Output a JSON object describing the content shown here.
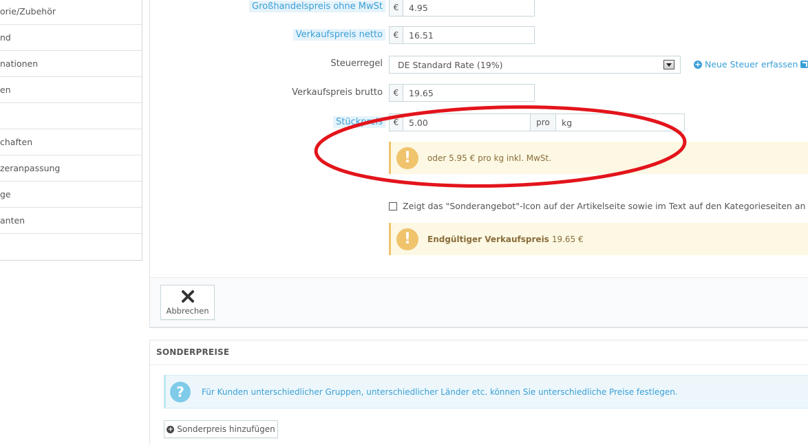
{
  "sidebar": {
    "items": [
      {
        "label": "orie/Zubehör"
      },
      {
        "label": "nd"
      },
      {
        "label": "nationen"
      },
      {
        "label": "en"
      },
      {
        "label": ""
      },
      {
        "label": "chaften"
      },
      {
        "label": "zeranpassung"
      },
      {
        "label": "ge"
      },
      {
        "label": "anten"
      },
      {
        "label": ""
      }
    ]
  },
  "pricing": {
    "wholesale_label": "Großhandelspreis ohne MwSt",
    "wholesale_currency": "€",
    "wholesale_value": "4.95",
    "net_label": "Verkaufspreis netto",
    "net_currency": "€",
    "net_value": "16.51",
    "tax_rule_label": "Steuerregel",
    "tax_rule_value": "DE Standard Rate (19%)",
    "new_tax_link": "Neue Steuer erfassen",
    "gross_label": "Verkaufspreis brutto",
    "gross_currency": "€",
    "gross_value": "19.65",
    "unit_label": "Stückpreis",
    "unit_currency": "€",
    "unit_value": "5.00",
    "unit_per": "pro",
    "unit_name": "kg",
    "unit_alert": "oder 5.95 € pro kg inkl. MwSt.",
    "special_offer_checkbox": "Zeigt das \"Sonderangebot\"-Icon auf der Artikelseite sowie im Text auf den Kategorieseiten an",
    "final_price_label": "Endgültiger Verkaufspreis",
    "final_price_value": "19.65 €"
  },
  "footer": {
    "cancel_label": "Abbrechen"
  },
  "special_prices": {
    "title": "SONDERPREISE",
    "info_text": "Für Kunden unterschiedlicher Gruppen, unterschiedlicher Länder etc. können Sie unterschiedliche Preise festlegen.",
    "add_button": "Sonderpreis hinzufügen"
  },
  "colors": {
    "accent": "#3a9fd6",
    "warning_bg": "#fcf8e3",
    "warning_icon": "#f0c36d",
    "annotation_red": "#e3141b"
  },
  "icons": {
    "tax_link": "plus-circle-icon",
    "external": "external-link-icon",
    "warning": "exclamation-icon",
    "cancel": "close-icon",
    "info": "question-icon",
    "add": "plus-circle-icon"
  }
}
